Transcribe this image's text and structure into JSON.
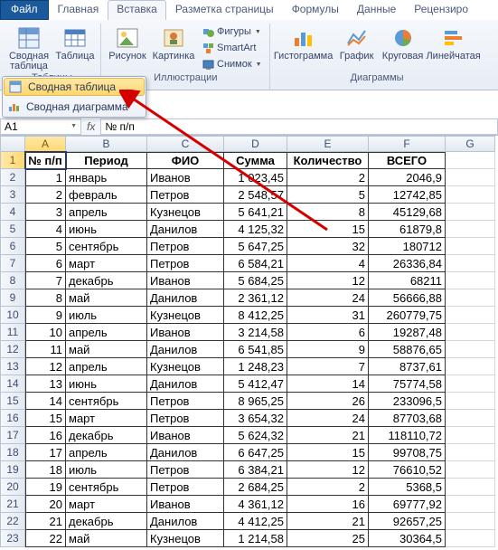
{
  "tabs": {
    "file": "Файл",
    "home": "Главная",
    "insert": "Вставка",
    "pagelayout": "Разметка страницы",
    "formulas": "Формулы",
    "data": "Данные",
    "review": "Рецензиро"
  },
  "ribbon": {
    "tables": {
      "pivot": "Сводная\nтаблица",
      "table": "Таблица",
      "group_label": "Таблицы"
    },
    "illustrations": {
      "picture": "Рисунок",
      "clipart": "Картинка",
      "shapes": "Фигуры",
      "smartart": "SmartArt",
      "screenshot": "Снимок",
      "group_label": "Иллюстрации"
    },
    "charts": {
      "column": "Гистограмма",
      "line": "График",
      "pie": "Круговая",
      "bar": "Линейчатая",
      "group_label": "Диаграммы"
    }
  },
  "dropdown": {
    "pivot_table": "Сводная таблица",
    "pivot_chart": "Сводная диаграмма"
  },
  "namebox": "A1",
  "fx_label": "fx",
  "formula_value": "№ п/п",
  "columns": [
    "A",
    "B",
    "C",
    "D",
    "E",
    "F",
    "G"
  ],
  "headers": [
    "№ п/п",
    "Период",
    "ФИО",
    "Сумма",
    "Количество",
    "ВСЕГО"
  ],
  "rows": [
    {
      "n": "1",
      "p": "январь",
      "f": "Иванов",
      "s": "1 023,45",
      "k": "2",
      "v": "2046,9"
    },
    {
      "n": "2",
      "p": "февраль",
      "f": "Петров",
      "s": "2 548,57",
      "k": "5",
      "v": "12742,85"
    },
    {
      "n": "3",
      "p": "апрель",
      "f": "Кузнецов",
      "s": "5 641,21",
      "k": "8",
      "v": "45129,68"
    },
    {
      "n": "4",
      "p": "июнь",
      "f": "Данилов",
      "s": "4 125,32",
      "k": "15",
      "v": "61879,8"
    },
    {
      "n": "5",
      "p": "сентябрь",
      "f": "Петров",
      "s": "5 647,25",
      "k": "32",
      "v": "180712"
    },
    {
      "n": "6",
      "p": "март",
      "f": "Петров",
      "s": "6 584,21",
      "k": "4",
      "v": "26336,84"
    },
    {
      "n": "7",
      "p": "декабрь",
      "f": "Иванов",
      "s": "5 684,25",
      "k": "12",
      "v": "68211"
    },
    {
      "n": "8",
      "p": "май",
      "f": "Данилов",
      "s": "2 361,12",
      "k": "24",
      "v": "56666,88"
    },
    {
      "n": "9",
      "p": "июль",
      "f": "Кузнецов",
      "s": "8 412,25",
      "k": "31",
      "v": "260779,75"
    },
    {
      "n": "10",
      "p": "апрель",
      "f": "Иванов",
      "s": "3 214,58",
      "k": "6",
      "v": "19287,48"
    },
    {
      "n": "11",
      "p": "май",
      "f": "Данилов",
      "s": "6 541,85",
      "k": "9",
      "v": "58876,65"
    },
    {
      "n": "12",
      "p": "апрель",
      "f": "Кузнецов",
      "s": "1 248,23",
      "k": "7",
      "v": "8737,61"
    },
    {
      "n": "13",
      "p": "июнь",
      "f": "Данилов",
      "s": "5 412,47",
      "k": "14",
      "v": "75774,58"
    },
    {
      "n": "14",
      "p": "сентябрь",
      "f": "Петров",
      "s": "8 965,25",
      "k": "26",
      "v": "233096,5"
    },
    {
      "n": "15",
      "p": "март",
      "f": "Петров",
      "s": "3 654,32",
      "k": "24",
      "v": "87703,68"
    },
    {
      "n": "16",
      "p": "декабрь",
      "f": "Иванов",
      "s": "5 624,32",
      "k": "21",
      "v": "118110,72"
    },
    {
      "n": "17",
      "p": "апрель",
      "f": "Данилов",
      "s": "6 647,25",
      "k": "15",
      "v": "99708,75"
    },
    {
      "n": "18",
      "p": "июль",
      "f": "Петров",
      "s": "6 384,21",
      "k": "12",
      "v": "76610,52"
    },
    {
      "n": "19",
      "p": "сентябрь",
      "f": "Петров",
      "s": "2 684,25",
      "k": "2",
      "v": "5368,5"
    },
    {
      "n": "20",
      "p": "март",
      "f": "Иванов",
      "s": "4 361,12",
      "k": "16",
      "v": "69777,92"
    },
    {
      "n": "21",
      "p": "декабрь",
      "f": "Данилов",
      "s": "4 412,25",
      "k": "21",
      "v": "92657,25"
    },
    {
      "n": "22",
      "p": "май",
      "f": "Кузнецов",
      "s": "1 214,58",
      "k": "25",
      "v": "30364,5"
    }
  ]
}
